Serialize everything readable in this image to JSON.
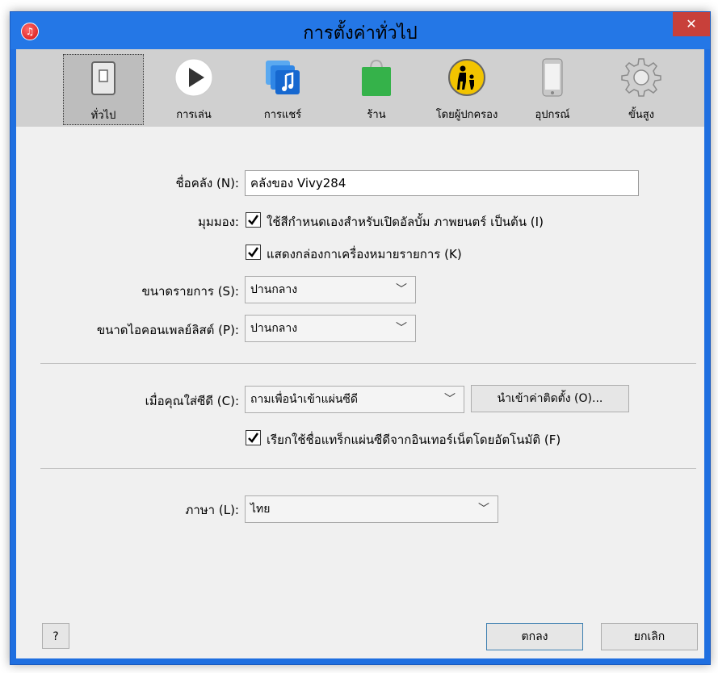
{
  "window": {
    "title": "การตั้งค่าทั่วไป",
    "close_label": "✕"
  },
  "toolbar": {
    "items": [
      {
        "label": "ทั่วไป",
        "icon": "switch-icon"
      },
      {
        "label": "การเล่น",
        "icon": "play-icon"
      },
      {
        "label": "การแชร์",
        "icon": "music-share-icon"
      },
      {
        "label": "ร้าน",
        "icon": "shopping-bag-icon"
      },
      {
        "label": "โดยผู้ปกครอง",
        "icon": "parental-icon"
      },
      {
        "label": "อุปกรณ์",
        "icon": "phone-icon"
      },
      {
        "label": "ขั้นสูง",
        "icon": "gear-icon"
      }
    ]
  },
  "form": {
    "library_name_label": "ชื่อคลัง (N):",
    "library_name_value": "คลังของ Vivy284",
    "views_label": "มุมมอง:",
    "custom_colors_label": "ใช้สีกำหนดเองสำหรับเปิดอัลบั้ม ภาพยนตร์ เป็นต้น (I)",
    "show_checkboxes_label": "แสดงกล่องกาเครื่องหมายรายการ (K)",
    "list_size_label": "ขนาดรายการ (S):",
    "list_size_value": "ปานกลาง",
    "playlist_icon_size_label": "ขนาดไอคอนเพลย์ลิสต์ (P):",
    "playlist_icon_size_value": "ปานกลาง",
    "cd_insert_label": "เมื่อคุณใส่ซีดี (C):",
    "cd_insert_value": "ถามเพื่อนำเข้าแผ่นซีดี",
    "import_settings_button": "นำเข้าค่าติดตั้ง (O)...",
    "retrieve_cd_names_label": "เรียกใช้ชื่อแทร็กแผ่นซีดีจากอินเทอร์เน็ตโดยอัตโนมัติ (F)",
    "language_label": "ภาษา (L):",
    "language_value": "ไทย"
  },
  "footer": {
    "help_label": "?",
    "ok_label": "ตกลง",
    "cancel_label": "ยกเลิก"
  },
  "colors": {
    "titlebar": "#2477e6",
    "close": "#c8403a",
    "content": "#f0f0f0",
    "toolbar": "#d0d0d0"
  }
}
